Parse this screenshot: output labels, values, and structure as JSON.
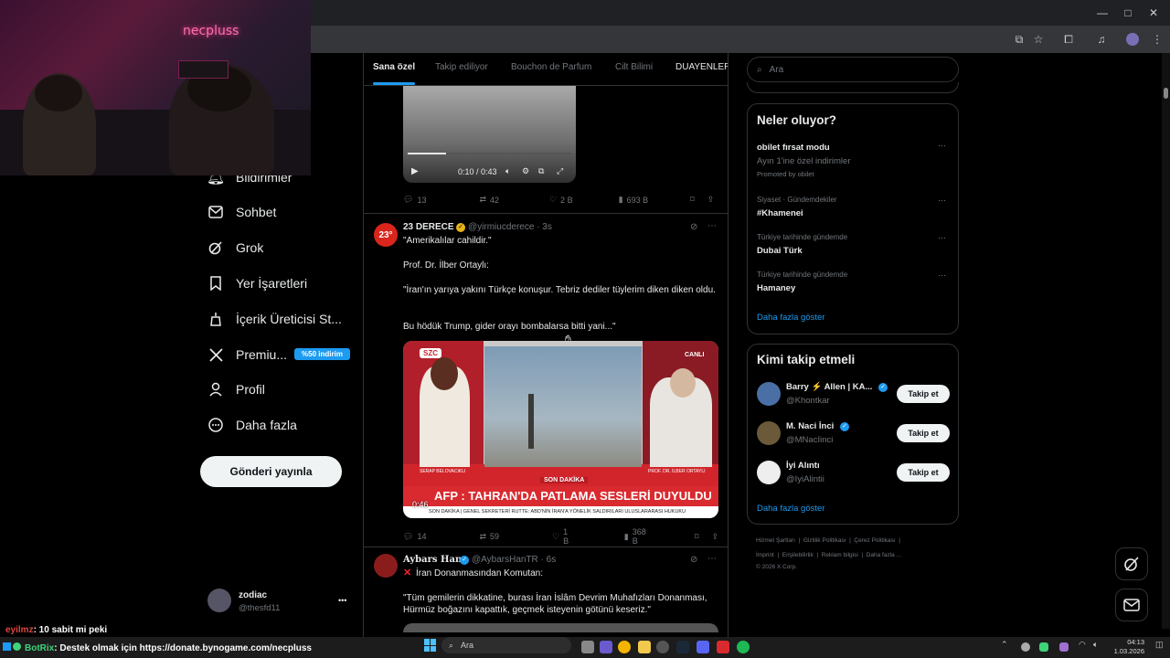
{
  "browser": {
    "tabs": [],
    "win_min": "—",
    "win_max": "□",
    "win_close": "✕"
  },
  "webcam": {
    "logo": "necpluss"
  },
  "nav": {
    "items": [
      {
        "label": "Bildirimler",
        "icon": "bell-icon"
      },
      {
        "label": "Sohbet",
        "icon": "mail-icon"
      },
      {
        "label": "Grok",
        "icon": "grok-icon"
      },
      {
        "label": "Yer İşaretleri",
        "icon": "bookmark-icon"
      },
      {
        "label": "İçerik Üreticisi St...",
        "icon": "creator-icon"
      },
      {
        "label": "Premiu...",
        "icon": "x-logo-icon",
        "badge": "%50 indirim"
      },
      {
        "label": "Profil",
        "icon": "person-icon"
      },
      {
        "label": "Daha fazla",
        "icon": "more-circle-icon"
      }
    ],
    "post_button": "Gönderi yayınla",
    "account": {
      "name": "zodiac",
      "handle": "@thesfd11",
      "more": "•••"
    }
  },
  "feed": {
    "tabs": [
      "Sana özel",
      "Takip ediliyor",
      "Bouchon de Parfum",
      "Cilt Bilimi",
      "DUAYENLER"
    ],
    "video_time": "0:10 / 0:43",
    "post0_actions": {
      "replies": "13",
      "reposts": "42",
      "likes": "2 B",
      "views": "693 B"
    },
    "post1": {
      "avatar": "23°",
      "name": "23 DERECE",
      "handle": "@yirmiucderece · 3s",
      "lines": [
        "\"Amerikalılar cahildir.\"",
        "Prof. Dr. İlber Ortaylı:",
        "\"İran'ın yarıya yakını Türkçe konuşur. Tebriz dediler tüylerim diken diken oldu.",
        "Bu hödük Trump, gider orayı bombalarsa bitti yani...\""
      ],
      "media": {
        "channel": "SZC",
        "live": "CANLI",
        "son_dakika": "SON DAKİKA",
        "headline": "AFP : TAHRAN'DA PATLAMA SESLERİ DUYULDU",
        "ticker": "SON DAKİKA | GENEL SEKRETERİ RUTTE: ABD'NİN İRAN'A YÖNELİK SALDIRILARI ULUSLARARASI HUKUKU",
        "duration": "0:46",
        "left_name": "SERAP BELOVACIKLI",
        "right_name": "PROF. DR. İLBER ORTAYLI"
      },
      "actions": {
        "replies": "14",
        "reposts": "59",
        "likes": "1 B",
        "views": "368 B"
      }
    },
    "post2": {
      "name": "Aybars Han",
      "handle": "@AybarsHanTR · 6s",
      "lines": [
        "İran Donanmasından Komutan:",
        "\"Tüm gemilerin dikkatine, burası İran İslâm Devrim Muhafızları Donanması, Hürmüz boğazını kapattık, geçmek isteyenin götünü keseriz.\""
      ]
    }
  },
  "right": {
    "search_placeholder": "Ara",
    "trends_title": "Neler oluyor?",
    "trends": [
      {
        "cat": "",
        "name": "obilet fırsat modu",
        "sub": "Ayın 1'ine özel indirimler",
        "promo": "Promoted by obilet"
      },
      {
        "cat": "Siyaset · Gündemdekiler",
        "name": "#Khamenei"
      },
      {
        "cat": "Türkiye tarihinde gündemde",
        "name": "Dubai Türk"
      },
      {
        "cat": "Türkiye tarihinde gündemde",
        "name": "Hamaney"
      }
    ],
    "show_more": "Daha fazla göster",
    "who_title": "Kimi takip etmeli",
    "who": [
      {
        "name": "Barry ⚡ Allen | KA...",
        "handle": "@Khontkar",
        "btn": "Takip et",
        "color": "#4a6fa5"
      },
      {
        "name": "M. Naci İnci",
        "handle": "@MNacIinci",
        "btn": "Takip et",
        "color": "#6b5a3a"
      },
      {
        "name": "İyi Alıntı",
        "handle": "@IyiAlintii",
        "btn": "Takip et",
        "color": "#eeeeee"
      }
    ],
    "who_more": "Daha fazla göster",
    "footer_line1": [
      "Hizmet Şartları",
      "Gizlilik Politikası",
      "Çerez Politikası"
    ],
    "footer_line2": [
      "İmprint",
      "Erişilebilirlik",
      "Reklam bilgisi",
      "Daha fazla ..."
    ],
    "copyright": "© 2026 X Corp."
  },
  "chat": [
    {
      "user": "eyilmz",
      "msg": ": 10 sabit mi peki",
      "color": "#e0453f"
    },
    {
      "user": "BotRix",
      "msg": ": Destek olmak için https://donate.bynogame.com/necpluss",
      "color": "#3fd37a"
    }
  ],
  "taskbar": {
    "search": "Ara",
    "time": "04:13",
    "date": "1.03.2026"
  },
  "colors": {
    "accent": "#1d9bf0",
    "bg": "#000000",
    "border": "#2f3336"
  }
}
